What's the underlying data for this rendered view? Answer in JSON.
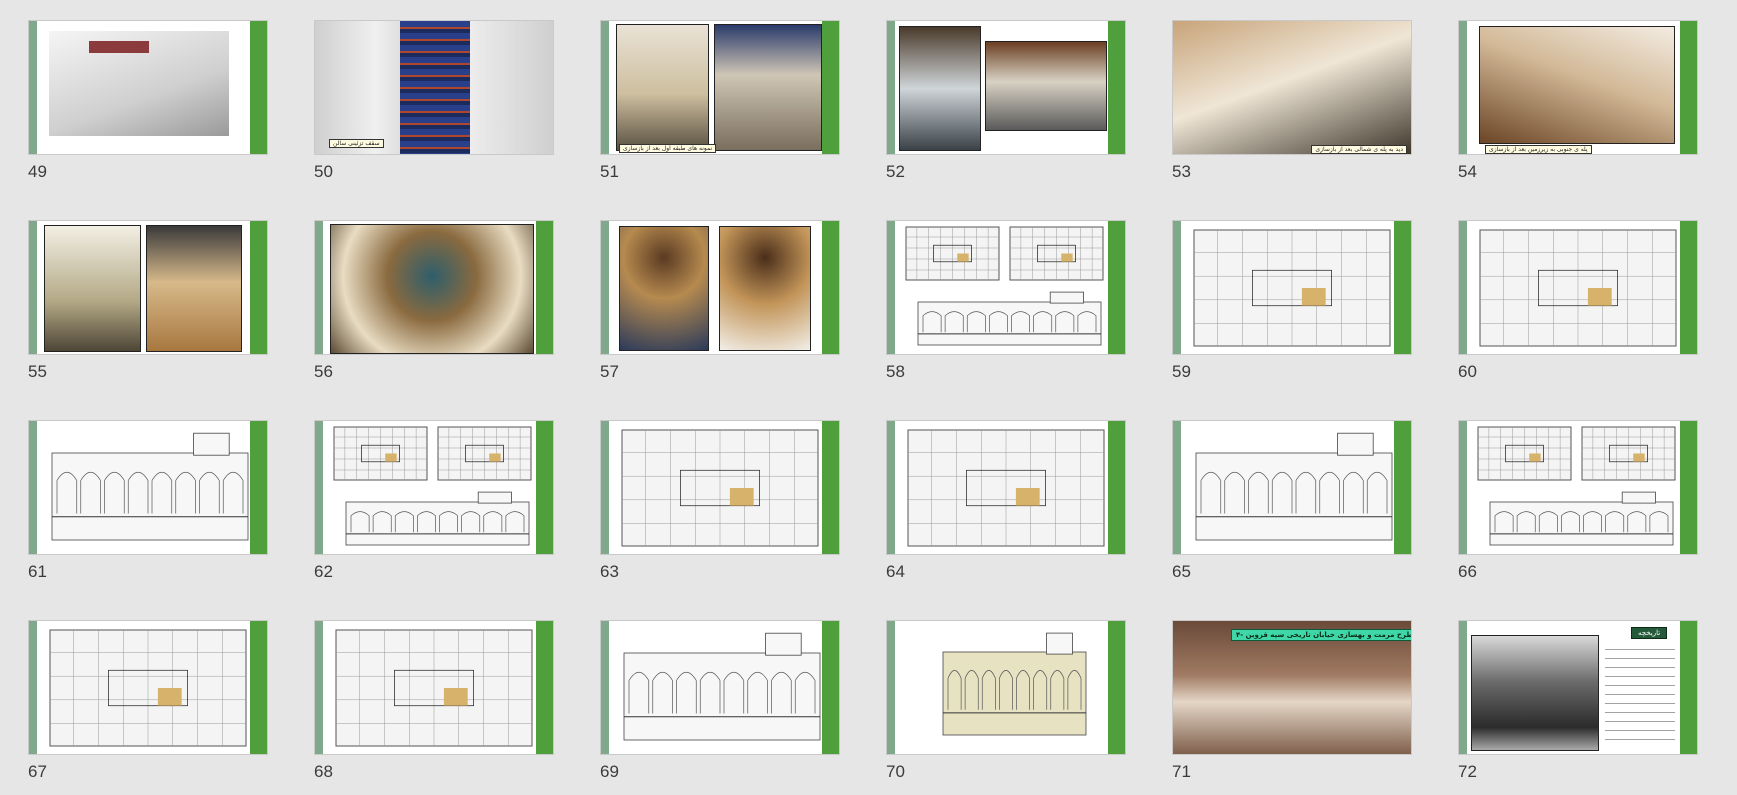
{
  "view": "slide-sorter",
  "slides": [
    {
      "number": "49",
      "kind": "render"
    },
    {
      "number": "50",
      "kind": "ceiling",
      "caption": "سقف تزئینی سالن"
    },
    {
      "number": "51",
      "kind": "two-photo",
      "caption": "نمونه های طبقه اول بعد از بازسازی"
    },
    {
      "number": "52",
      "kind": "two-photo-b"
    },
    {
      "number": "53",
      "kind": "stairs",
      "caption": "دید به پله ی شمالی بعد از بازسازی"
    },
    {
      "number": "54",
      "kind": "stairs-b",
      "caption": "پله ی جنوبی به زیرزمین بعد از بازسازی"
    },
    {
      "number": "55",
      "kind": "two-photo-c"
    },
    {
      "number": "56",
      "kind": "dome"
    },
    {
      "number": "57",
      "kind": "two-arch"
    },
    {
      "number": "58",
      "kind": "plans-section"
    },
    {
      "number": "59",
      "kind": "plan"
    },
    {
      "number": "60",
      "kind": "plan"
    },
    {
      "number": "61",
      "kind": "section"
    },
    {
      "number": "62",
      "kind": "plans-section"
    },
    {
      "number": "63",
      "kind": "plan"
    },
    {
      "number": "64",
      "kind": "plan"
    },
    {
      "number": "65",
      "kind": "section"
    },
    {
      "number": "66",
      "kind": "plans-section"
    },
    {
      "number": "67",
      "kind": "plan"
    },
    {
      "number": "68",
      "kind": "plan"
    },
    {
      "number": "69",
      "kind": "section"
    },
    {
      "number": "70",
      "kind": "elevation"
    },
    {
      "number": "71",
      "kind": "history",
      "title": "۴- طرح مرمت و بهسازی خیابان تاریخی سپه قزوین"
    },
    {
      "number": "72",
      "kind": "history-b",
      "title": "تاریخچه"
    }
  ],
  "colors": {
    "background": "#e6e6e6",
    "accent_green": "#4f9f3c",
    "sage": "#7fa98a"
  }
}
